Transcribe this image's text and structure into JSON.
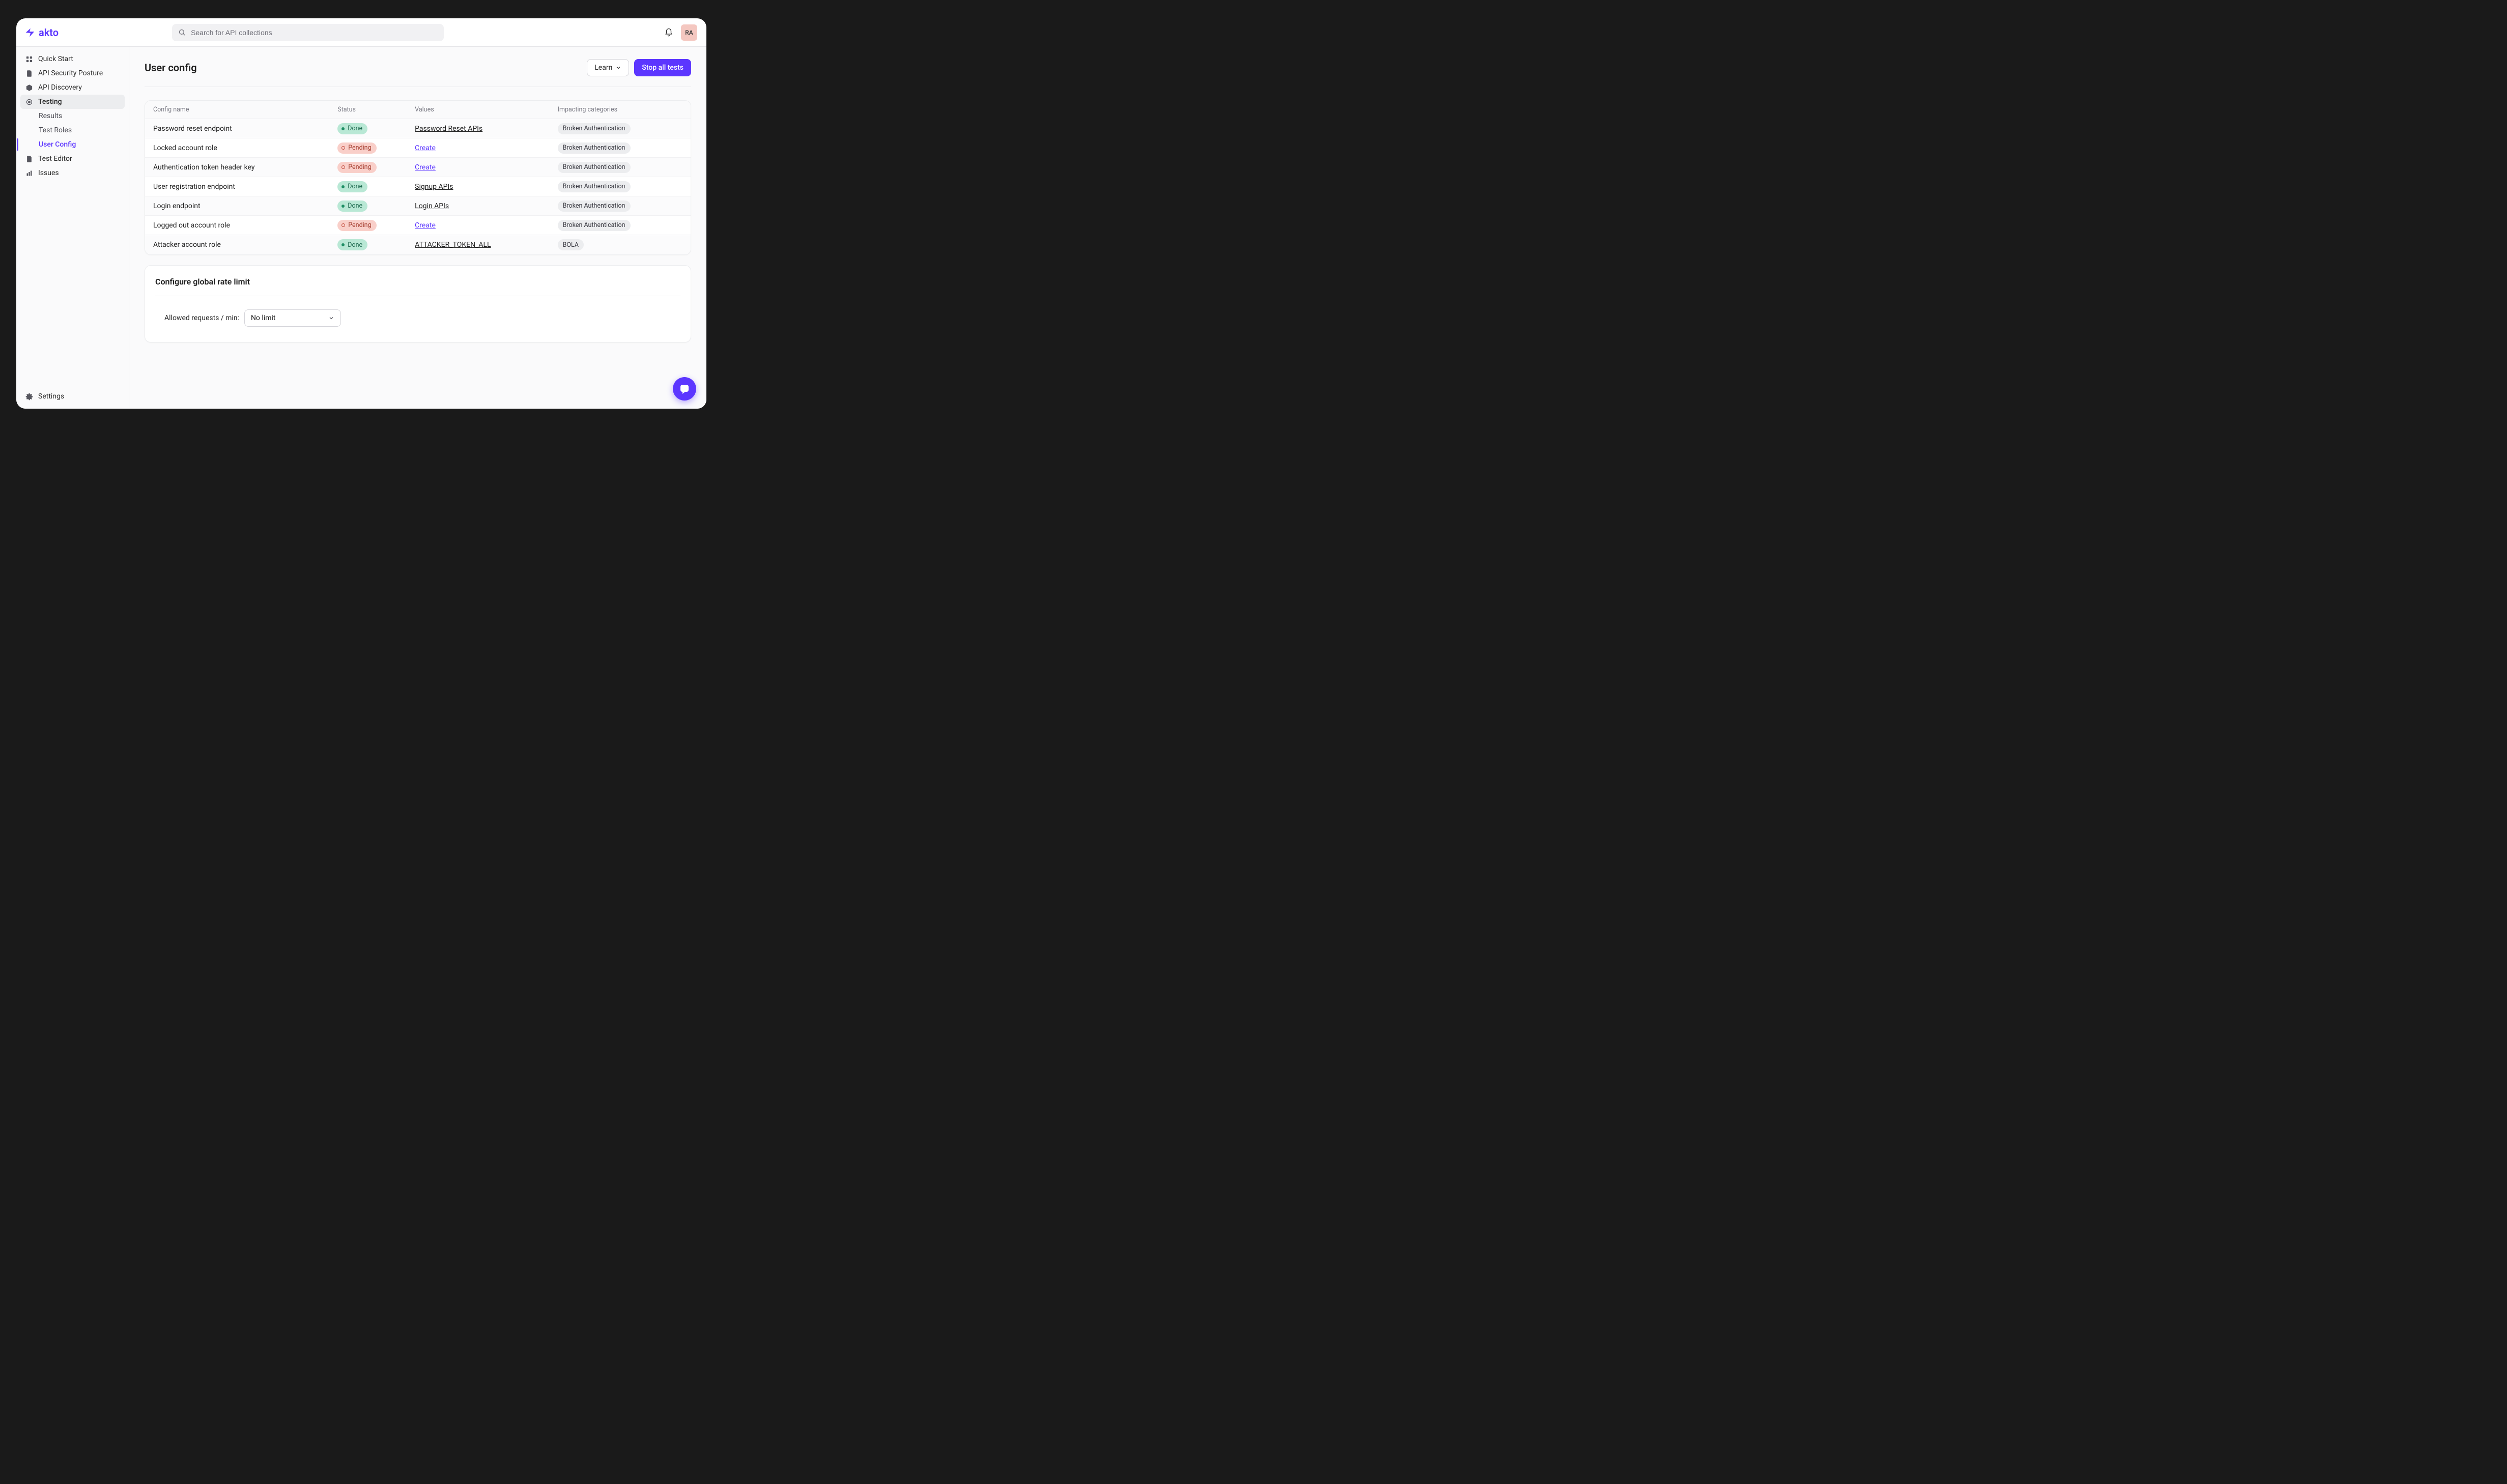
{
  "brand": {
    "name": "akto"
  },
  "search": {
    "placeholder": "Search for API collections"
  },
  "avatar": {
    "initials": "RA"
  },
  "sidebar": {
    "items": [
      {
        "label": "Quick Start"
      },
      {
        "label": "API Security Posture"
      },
      {
        "label": "API Discovery"
      },
      {
        "label": "Testing"
      },
      {
        "label": "Test Editor"
      },
      {
        "label": "Issues"
      }
    ],
    "testing_sub": [
      {
        "label": "Results"
      },
      {
        "label": "Test Roles"
      },
      {
        "label": "User Config"
      }
    ],
    "settings_label": "Settings"
  },
  "page": {
    "title": "User config",
    "learn_label": "Learn",
    "stop_label": "Stop all tests"
  },
  "table": {
    "headers": {
      "name": "Config name",
      "status": "Status",
      "values": "Values",
      "categories": "Impacting categories"
    },
    "status_labels": {
      "done": "Done",
      "pending": "Pending"
    },
    "rows": [
      {
        "name": "Password reset endpoint",
        "status": "done",
        "value": "Password Reset APIs",
        "link_style": "normal",
        "category": "Broken Authentication"
      },
      {
        "name": "Locked account role",
        "status": "pending",
        "value": "Create",
        "link_style": "create",
        "category": "Broken Authentication"
      },
      {
        "name": "Authentication token header key",
        "status": "pending",
        "value": "Create",
        "link_style": "create",
        "category": "Broken Authentication"
      },
      {
        "name": "User registration endpoint",
        "status": "done",
        "value": "Signup APIs",
        "link_style": "normal",
        "category": "Broken Authentication"
      },
      {
        "name": "Login endpoint",
        "status": "done",
        "value": "Login APIs",
        "link_style": "normal",
        "category": "Broken Authentication"
      },
      {
        "name": "Logged out account role",
        "status": "pending",
        "value": "Create",
        "link_style": "create",
        "category": "Broken Authentication"
      },
      {
        "name": "Attacker account role",
        "status": "done",
        "value": "ATTACKER_TOKEN_ALL",
        "link_style": "normal",
        "category": "BOLA"
      }
    ]
  },
  "rate_limit": {
    "title": "Configure global rate limit",
    "label": "Allowed requests / min:",
    "selected": "No limit"
  }
}
